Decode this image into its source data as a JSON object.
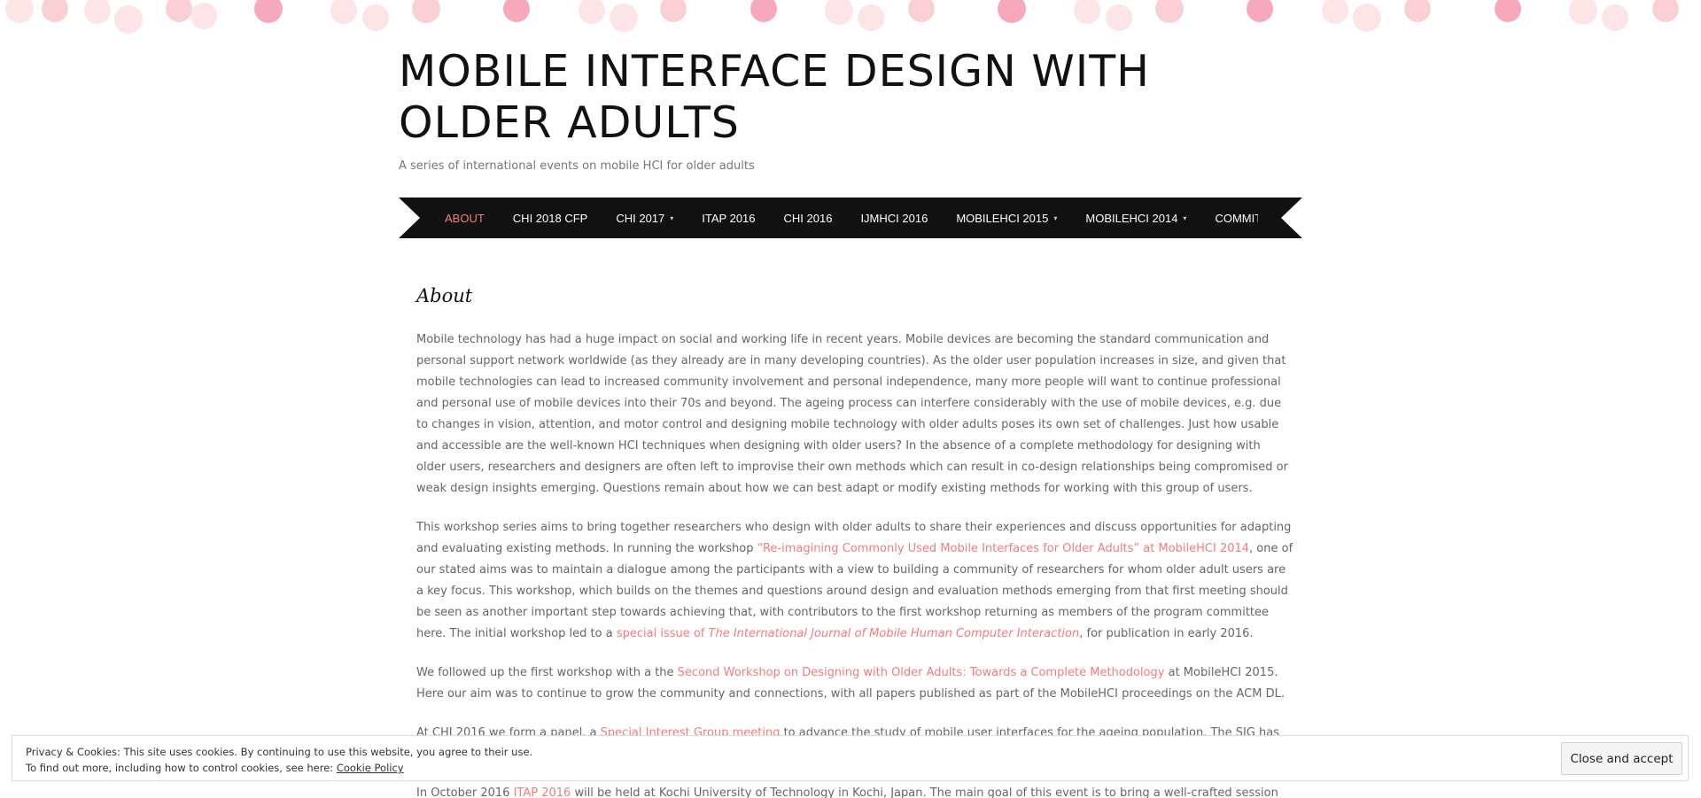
{
  "site": {
    "title": "MOBILE INTERFACE DESIGN WITH OLDER ADULTS",
    "description": "A series of international events on mobile HCI for older adults"
  },
  "nav": {
    "items": [
      {
        "label": "ABOUT",
        "active": true,
        "has_submenu": false
      },
      {
        "label": "CHI 2018 CFP",
        "active": false,
        "has_submenu": false
      },
      {
        "label": "CHI 2017",
        "active": false,
        "has_submenu": true
      },
      {
        "label": "ITAP 2016",
        "active": false,
        "has_submenu": false
      },
      {
        "label": "CHI 2016",
        "active": false,
        "has_submenu": false
      },
      {
        "label": "IJMHCI 2016",
        "active": false,
        "has_submenu": false
      },
      {
        "label": "MOBILEHCI 2015",
        "active": false,
        "has_submenu": true
      },
      {
        "label": "MOBILEHCI 2014",
        "active": false,
        "has_submenu": true
      },
      {
        "label": "COMMIT",
        "active": false,
        "has_submenu": false
      }
    ],
    "caret_icon": "chevron-down-icon"
  },
  "page": {
    "title": "About",
    "p1": "Mobile technology has had a huge impact on social and working life in recent years. Mobile devices are becoming the standard communication and personal support network worldwide (as they already are in many developing countries). As the older user population increases in size, and given that mobile technologies can lead to increased community involvement and personal independence, many more people will want to continue professional and personal use of mobile devices into their 70s and beyond. The ageing process can interfere considerably with the use of mobile devices, e.g. due to changes in vision, attention, and motor control and designing mobile technology with older adults poses its own set of challenges. Just how usable and accessible are the well-known HCI techniques when designing with older users? In the absence of a complete methodology for designing with older users, researchers and designers are often left to improvise their own methods which can result in co-design relationships being compromised or weak design insights emerging. Questions remain about how we can best adapt or modify existing methods for working with this group of users.",
    "p2": {
      "t1": "This workshop series aims to bring together researchers who design with older adults to share their experiences and discuss opportunities for adapting and evaluating existing methods. In running the workshop ",
      "link1": "“Re-imagining Commonly Used Mobile Interfaces for Older Adults” at MobileHCI 2014",
      "t2": ", one of our stated aims was to maintain a dialogue among the participants with a view to building a community of researchers for whom older adult users are a key focus. This workshop, which builds on the themes and questions around design and evaluation methods emerging from that first meeting should be seen as another important step towards achieving that, with contributors to the first workshop returning as members of the program committee here. The initial workshop led to a ",
      "link2": "special issue of ",
      "link3": "The International Journal of Mobile Human Computer Interaction",
      "t3": ", for publication in early 2016."
    },
    "p3": {
      "t1": "We followed up the first workshop with a the ",
      "link1": "Second Workshop on Designing with Older Adults: Towards a Complete Methodology",
      "t2": " at MobileHCI 2015. Here our aim was to continue to grow the community and connections, with all papers published as part of the MobileHCI proceedings on the ACM DL."
    },
    "p4": {
      "t1": "At CHI 2016 we form a panel, a ",
      "link1": "Special Interest Group meeting",
      "t2": " to advance the study of mobile user interfaces for the ageing population. The SIG has the remarkable"
    },
    "p5": {
      "t1": "In October 2016 ",
      "link1": "ITAP 2016",
      "t2": " will be held at Kochi University of Technology in Kochi, Japan. The main goal of this event is to bring a well-crafted session"
    }
  },
  "cookie": {
    "line1": "Privacy & Cookies: This site uses cookies. By continuing to use this website, you agree to their use.",
    "line2": "To find out more, including how to control cookies, see here: ",
    "link": "Cookie Policy",
    "button": "Close and accept"
  },
  "colors": {
    "accent": "#f37c7c",
    "nav_bg": "#111111",
    "dot_light": "#fde4e7",
    "dot_mid": "#fbcfd6",
    "dot_strong": "#f6a9bd"
  }
}
